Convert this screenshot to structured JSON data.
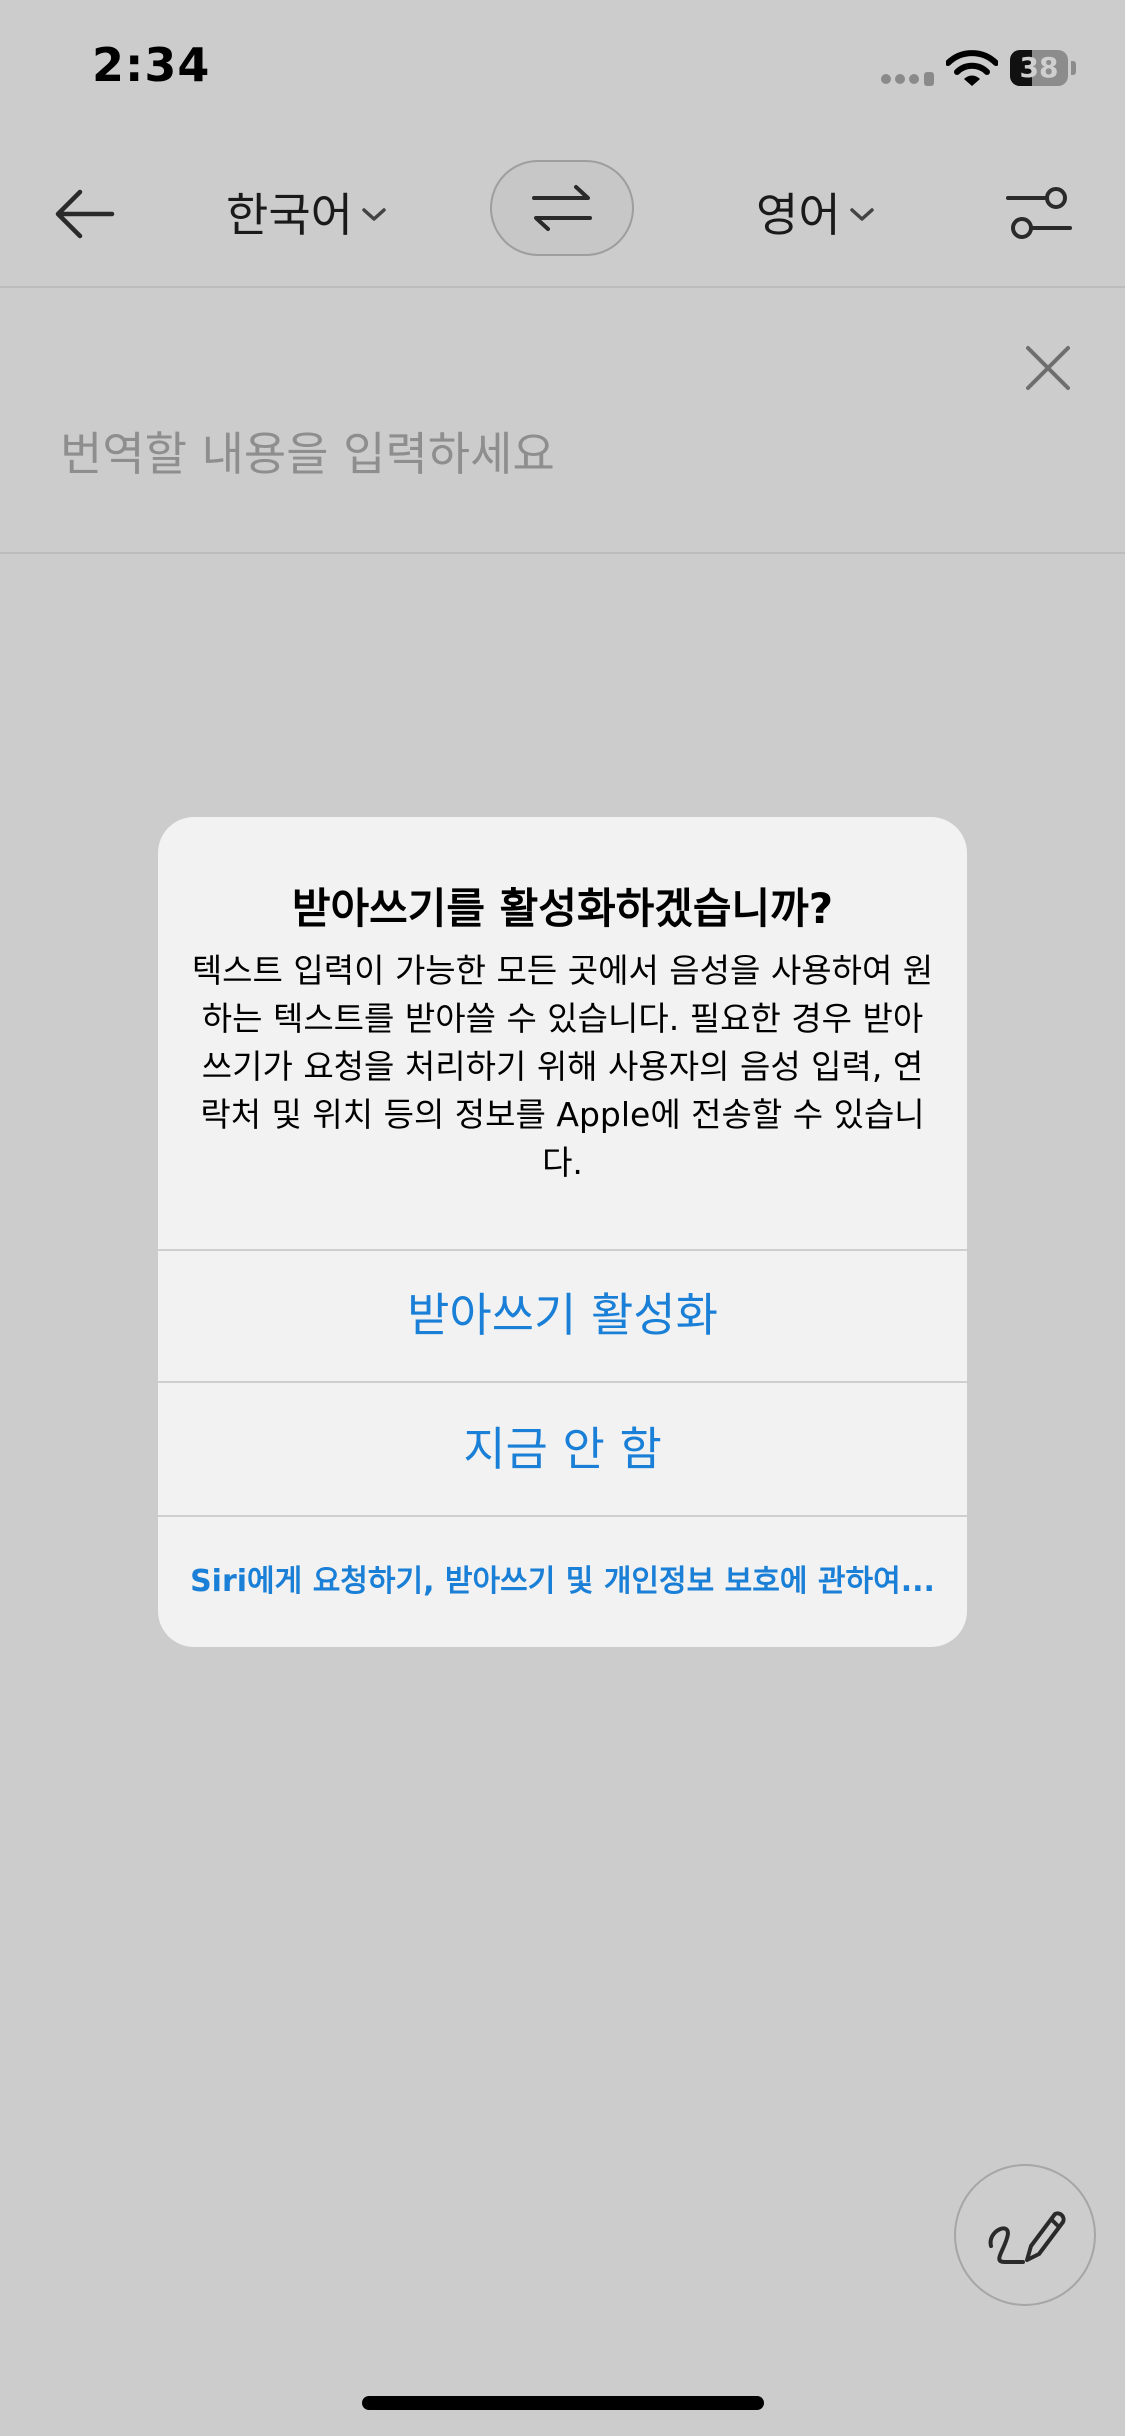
{
  "status_bar": {
    "time": "2:34",
    "battery_level": "38",
    "battery_fraction": 0.38
  },
  "toolbar": {
    "source_language": "한국어",
    "target_language": "영어",
    "back_icon": "arrow-left-icon",
    "swap_icon": "swap-arrows-icon",
    "settings_icon": "sliders-icon"
  },
  "input": {
    "placeholder": "번역할 내용을 입력하세요",
    "clear_icon": "close-icon"
  },
  "alert": {
    "title": "받아쓰기를 활성화하겠습니까?",
    "message": "텍스트 입력이 가능한 모든 곳에서 음성을 사용하여 원하는 텍스트를 받아쓸 수 있습니다. 필요한 경우 받아쓰기가 요청을 처리하기 위해 사용자의 음성 입력, 연락처 및 위치 등의 정보를 Apple에 전송할 수 있습니다.",
    "enable_label": "받아쓰기 활성화",
    "not_now_label": "지금 안 함",
    "about_link": "Siri에게 요청하기, 받아쓰기 및 개인정보 보호에 관하여..."
  },
  "handwriting": {
    "icon": "handwriting-pen-icon"
  },
  "colors": {
    "background": "#cccccc",
    "alert_background": "#f2f2f2",
    "accent": "#1a7fd6",
    "placeholder": "#8e8e8e"
  }
}
